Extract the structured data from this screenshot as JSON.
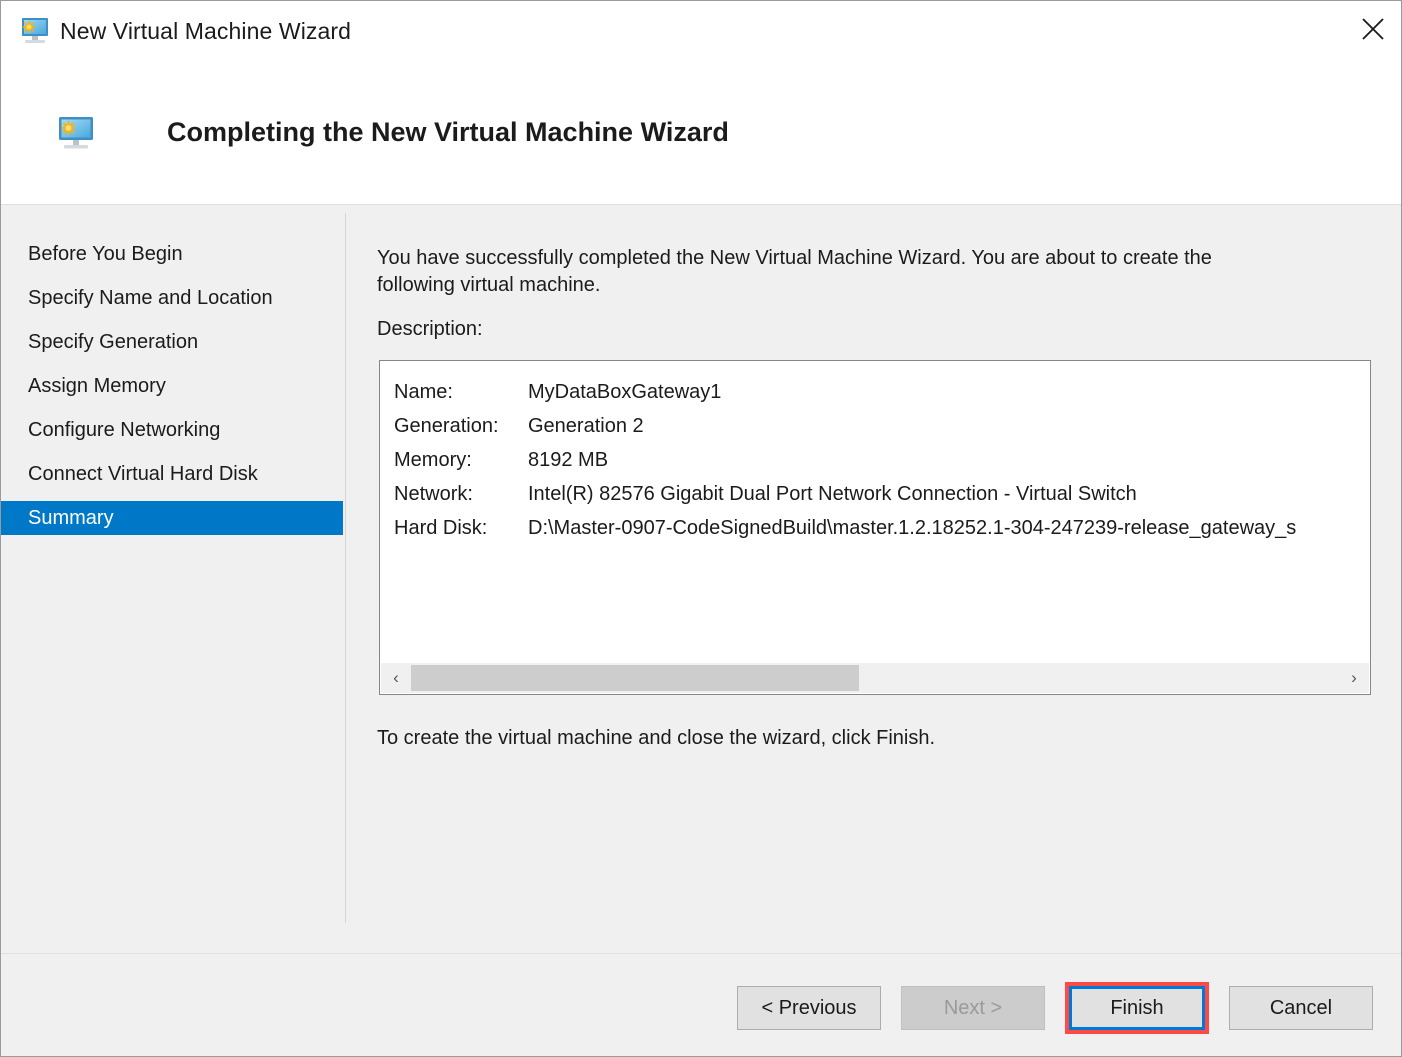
{
  "window": {
    "title": "New Virtual Machine Wizard",
    "title_icon": "virtual-machine-monitor-icon",
    "close_icon": "close-icon"
  },
  "header": {
    "title": "Completing the New Virtual Machine Wizard",
    "icon": "virtual-machine-monitor-icon"
  },
  "sidebar": {
    "items": [
      {
        "label": "Before You Begin",
        "selected": false
      },
      {
        "label": "Specify Name and Location",
        "selected": false
      },
      {
        "label": "Specify Generation",
        "selected": false
      },
      {
        "label": "Assign Memory",
        "selected": false
      },
      {
        "label": "Configure Networking",
        "selected": false
      },
      {
        "label": "Connect Virtual Hard Disk",
        "selected": false
      },
      {
        "label": "Summary",
        "selected": true
      }
    ]
  },
  "content": {
    "intro": "You have successfully completed the New Virtual Machine Wizard. You are about to create the following virtual machine.",
    "description_label": "Description:",
    "details": [
      {
        "key": "Name:",
        "value": "MyDataBoxGateway1"
      },
      {
        "key": "Generation:",
        "value": "Generation 2"
      },
      {
        "key": "Memory:",
        "value": "8192 MB"
      },
      {
        "key": "Network:",
        "value": "Intel(R) 82576 Gigabit Dual Port Network Connection - Virtual Switch"
      },
      {
        "key": "Hard Disk:",
        "value": "D:\\Master-0907-CodeSignedBuild\\master.1.2.18252.1-304-247239-release_gateway_s"
      }
    ],
    "scrollbar": {
      "left_arrow": "‹",
      "right_arrow": "›"
    },
    "finish_hint": "To create the virtual machine and close the wizard, click Finish."
  },
  "footer": {
    "previous_label": "< Previous",
    "next_label": "Next >",
    "finish_label": "Finish",
    "cancel_label": "Cancel"
  },
  "colors": {
    "selection_blue": "#0078c8",
    "focus_blue": "#0078d7",
    "highlight_red": "#fc4a46",
    "body_background": "#f0f0f0"
  }
}
